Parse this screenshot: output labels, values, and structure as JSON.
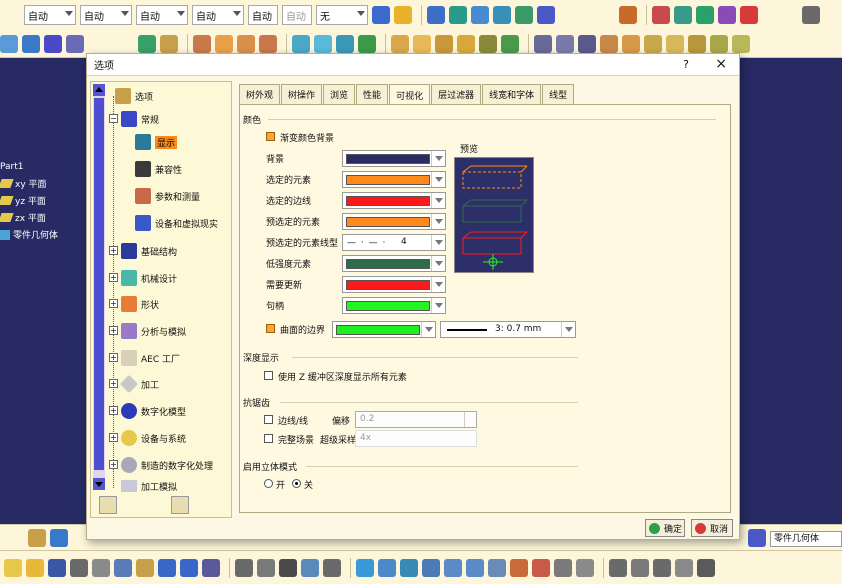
{
  "toolbar": {
    "combos": [
      "自动",
      "自动",
      "自动",
      "自动",
      "自动",
      "自动",
      "无"
    ]
  },
  "tree": {
    "root": "Part1",
    "items": [
      "xy 平面",
      "yz 平面",
      "zx 平面",
      "零件几何体"
    ]
  },
  "dialog": {
    "title": "选项",
    "help": "?",
    "close": "×",
    "categories": {
      "root": "选项",
      "general": "常规",
      "display": "显示",
      "compatibility": "兼容性",
      "parameters": "参数和测量",
      "devices": "设备和虚拟现实",
      "infrastructure": "基础结构",
      "mechanical": "机械设计",
      "shape": "形状",
      "analysis": "分析与模拟",
      "aec": "AEC 工厂",
      "machining": "加工",
      "digital_mockup": "数字化模型",
      "equipment": "设备与系统",
      "digital_process": "制造的数字化处理",
      "machining2": "加工模拟"
    },
    "tabs": [
      "树外观",
      "树操作",
      "浏览",
      "性能",
      "可视化",
      "层过滤器",
      "线宽和字体",
      "线型"
    ],
    "active_tab": 4,
    "color_section": {
      "title": "颜色",
      "gradient": "渐变颜色背景",
      "preview": "预览",
      "rows": [
        {
          "label": "背景",
          "color": "#2b2c63"
        },
        {
          "label": "选定的元素",
          "color": "#ff8a1a"
        },
        {
          "label": "选定的边线",
          "color": "#ff1a1a"
        },
        {
          "label": "预选定的元素",
          "color": "#ff8a1a"
        },
        {
          "label": "预选定的元素线型",
          "linetype": "4"
        },
        {
          "label": "低强度元素",
          "color": "#2f6d48"
        },
        {
          "label": "需要更新",
          "color": "#ff1a1a"
        },
        {
          "label": "句柄",
          "color": "#22f522"
        }
      ],
      "boundary_label": "曲面的边界",
      "boundary_color": "#1ef01e",
      "boundary_line": "3: 0.7 mm"
    },
    "depth_section": {
      "title": "深度显示",
      "option": "使用 Z 缓冲区深度显示所有元素"
    },
    "aa_section": {
      "title": "抗锯齿",
      "edges": "边线/线",
      "offset_label": "偏移",
      "offset_value": "0.2",
      "full_scene": "完整场景",
      "oversampling_label": "超级采样",
      "oversampling_value": "4x"
    },
    "stereo_section": {
      "title": "启用立体模式",
      "on": "开",
      "off": "关"
    },
    "buttons": {
      "ok": "确定",
      "cancel": "取消"
    }
  },
  "status": {
    "command": "零件几何体"
  }
}
